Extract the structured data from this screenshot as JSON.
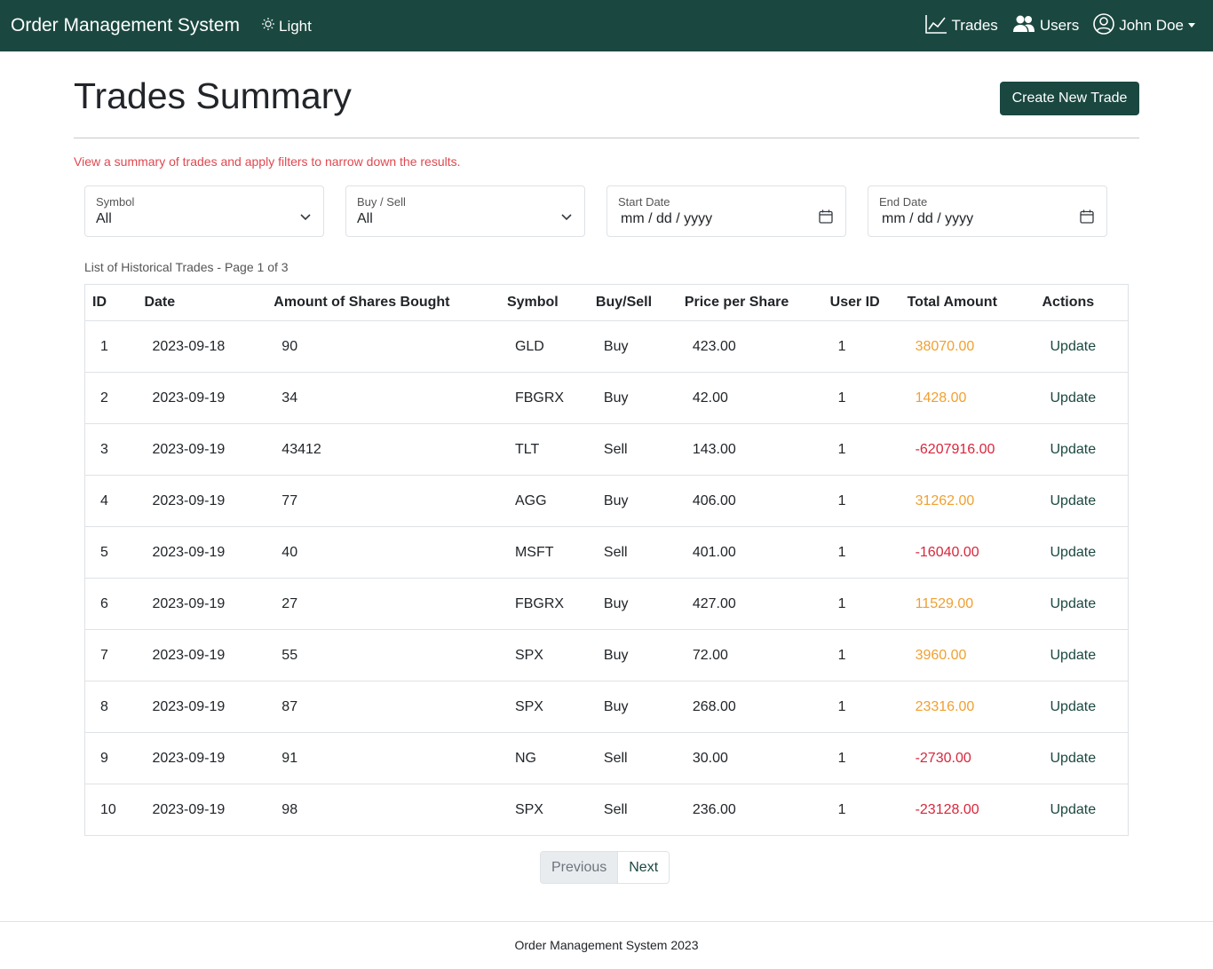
{
  "navbar": {
    "brand": "Order Management System",
    "theme_label": "Light",
    "links": {
      "trades": "Trades",
      "users": "Users",
      "profile": "John Doe"
    }
  },
  "header": {
    "title": "Trades Summary",
    "create_button": "Create New Trade",
    "description": "View a summary of trades and apply filters to narrow down the results."
  },
  "filters": {
    "symbol": {
      "label": "Symbol",
      "value": "All"
    },
    "buy_sell": {
      "label": "Buy / Sell",
      "value": "All"
    },
    "start_date": {
      "label": "Start Date",
      "value": "mm / dd / yyyy"
    },
    "end_date": {
      "label": "End Date",
      "value": "mm / dd / yyyy"
    }
  },
  "table": {
    "caption": "List of Historical Trades - Page 1 of 3",
    "headers": [
      "ID",
      "Date",
      "Amount of Shares Bought",
      "Symbol",
      "Buy/Sell",
      "Price per Share",
      "User ID",
      "Total Amount",
      "Actions"
    ],
    "rows": [
      {
        "id": "1",
        "date": "2023-09-18",
        "shares": "90",
        "symbol": "GLD",
        "side": "Buy",
        "price": "423.00",
        "user_id": "1",
        "total": "38070.00",
        "action": "Update"
      },
      {
        "id": "2",
        "date": "2023-09-19",
        "shares": "34",
        "symbol": "FBGRX",
        "side": "Buy",
        "price": "42.00",
        "user_id": "1",
        "total": "1428.00",
        "action": "Update"
      },
      {
        "id": "3",
        "date": "2023-09-19",
        "shares": "43412",
        "symbol": "TLT",
        "side": "Sell",
        "price": "143.00",
        "user_id": "1",
        "total": "-6207916.00",
        "action": "Update"
      },
      {
        "id": "4",
        "date": "2023-09-19",
        "shares": "77",
        "symbol": "AGG",
        "side": "Buy",
        "price": "406.00",
        "user_id": "1",
        "total": "31262.00",
        "action": "Update"
      },
      {
        "id": "5",
        "date": "2023-09-19",
        "shares": "40",
        "symbol": "MSFT",
        "side": "Sell",
        "price": "401.00",
        "user_id": "1",
        "total": "-16040.00",
        "action": "Update"
      },
      {
        "id": "6",
        "date": "2023-09-19",
        "shares": "27",
        "symbol": "FBGRX",
        "side": "Buy",
        "price": "427.00",
        "user_id": "1",
        "total": "11529.00",
        "action": "Update"
      },
      {
        "id": "7",
        "date": "2023-09-19",
        "shares": "55",
        "symbol": "SPX",
        "side": "Buy",
        "price": "72.00",
        "user_id": "1",
        "total": "3960.00",
        "action": "Update"
      },
      {
        "id": "8",
        "date": "2023-09-19",
        "shares": "87",
        "symbol": "SPX",
        "side": "Buy",
        "price": "268.00",
        "user_id": "1",
        "total": "23316.00",
        "action": "Update"
      },
      {
        "id": "9",
        "date": "2023-09-19",
        "shares": "91",
        "symbol": "NG",
        "side": "Sell",
        "price": "30.00",
        "user_id": "1",
        "total": "-2730.00",
        "action": "Update"
      },
      {
        "id": "10",
        "date": "2023-09-19",
        "shares": "98",
        "symbol": "SPX",
        "side": "Sell",
        "price": "236.00",
        "user_id": "1",
        "total": "-23128.00",
        "action": "Update"
      }
    ]
  },
  "pagination": {
    "previous": "Previous",
    "next": "Next"
  },
  "footer": {
    "text": "Order Management System 2023"
  },
  "colors": {
    "primary": "#1a4840",
    "buy_amount": "#f0a030",
    "sell_amount": "#d9263c",
    "description": "#e0484f"
  },
  "icons": [
    "sun-icon",
    "chart-line-icon",
    "users-icon",
    "user-circle-icon",
    "chevron-down-icon",
    "calendar-icon"
  ]
}
